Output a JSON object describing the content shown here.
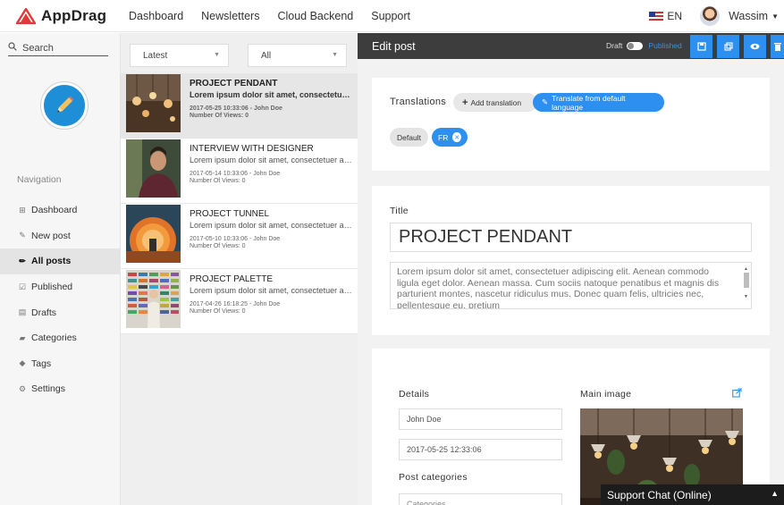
{
  "brand": {
    "name": "AppDrag",
    "color": "#e03a3a"
  },
  "topnav": {
    "menu": [
      "Dashboard",
      "Newsletters",
      "Cloud Backend",
      "Support"
    ],
    "lang": "EN",
    "user": "Wassim"
  },
  "sidebar": {
    "search_label": "Search",
    "heading": "Navigation",
    "items": [
      {
        "label": "Dashboard",
        "icon": "dashboard-icon"
      },
      {
        "label": "New post",
        "icon": "edit-icon"
      },
      {
        "label": "All posts",
        "icon": "pencil-icon"
      },
      {
        "label": "Published",
        "icon": "check-icon"
      },
      {
        "label": "Drafts",
        "icon": "file-icon"
      },
      {
        "label": "Categories",
        "icon": "book-icon"
      },
      {
        "label": "Tags",
        "icon": "tag-icon"
      },
      {
        "label": "Settings",
        "icon": "gear-icon"
      }
    ]
  },
  "filters": {
    "sort": "Latest",
    "category": "All"
  },
  "posts": [
    {
      "title": "PROJECT PENDANT",
      "excerpt": "Lorem ipsum dolor sit amet, consectetuer adipiscing elit.",
      "meta": "2017-05-25 10:33:06 - John Doe",
      "views": "Number Of Views: 0"
    },
    {
      "title": "INTERVIEW WITH DESIGNER",
      "excerpt": "Lorem ipsum dolor sit amet, consectetuer adipiscing elit.",
      "meta": "2017-05-14 10:33:06 - John Doe",
      "views": "Number Of Views: 0"
    },
    {
      "title": "PROJECT TUNNEL",
      "excerpt": "Lorem ipsum dolor sit amet, consectetuer adipiscing elit.",
      "meta": "2017-05-10 10:33:06 - John Doe",
      "views": "Number Of Views: 0"
    },
    {
      "title": "PROJECT PALETTE",
      "excerpt": "Lorem ipsum dolor sit amet, consectetuer adipiscing elit.",
      "meta": "2017-04-26 16:18:25 - John Doe",
      "views": "Number Of Views: 0"
    }
  ],
  "editor": {
    "title": "Edit post",
    "draft_label": "Draft",
    "published_label": "Published",
    "translations_label": "Translations",
    "add_translation": "Add translation",
    "translate_default": "Translate from default language",
    "lang_default": "Default",
    "lang_fr": "FR",
    "title_label": "Title",
    "title_value": "PROJECT PENDANT",
    "description": "Lorem ipsum dolor sit amet, consectetuer adipiscing elit. Aenean commodo ligula eget dolor. Aenean massa. Cum sociis natoque penatibus et magnis dis parturient montes, nascetur ridiculus mus. Donec quam felis, ultricies nec, pellentesque eu, pretium",
    "details_label": "Details",
    "author": "John Doe",
    "date": "2017-05-25 12:33:06",
    "post_categories_label": "Post categories",
    "categories_placeholder": "Categories",
    "main_image_label": "Main image"
  },
  "support_chat": "Support Chat (Online)",
  "colors": {
    "accent": "#2d8ff0",
    "header": "#3d3d3d",
    "brand": "#e03a3a"
  }
}
